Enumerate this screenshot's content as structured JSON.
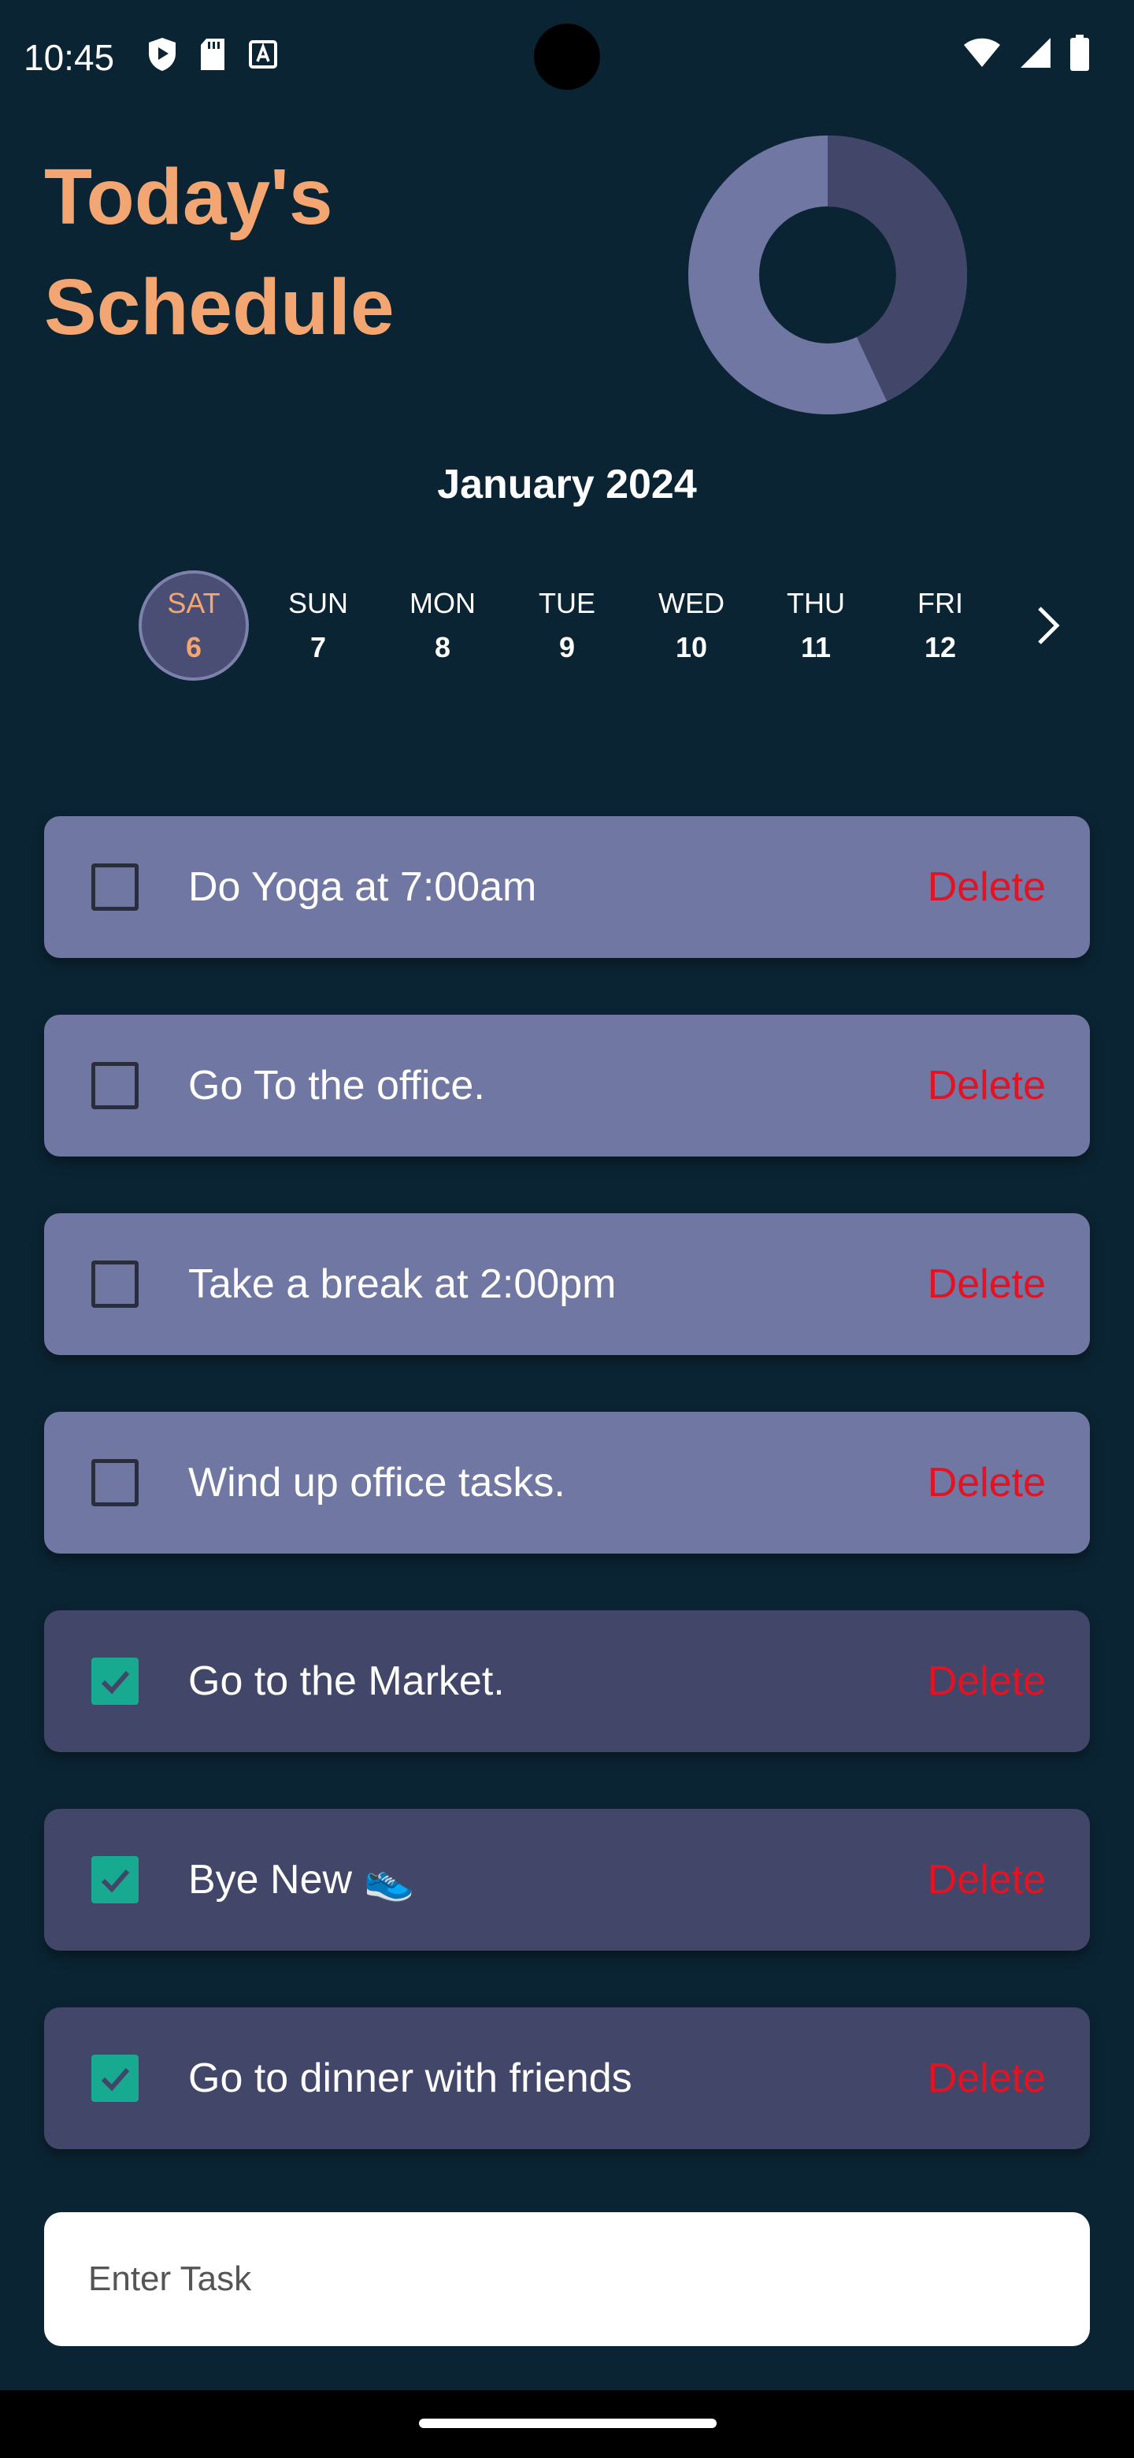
{
  "status_bar": {
    "time": "10:45",
    "left_icons": [
      "shield-icon",
      "sd-card-icon",
      "font-a-icon"
    ],
    "right_icons": [
      "wifi-icon",
      "signal-icon",
      "battery-icon"
    ]
  },
  "header": {
    "title": "Today's Schedule",
    "progress_chart": {
      "completed_fraction": 0.43,
      "colors": {
        "pending": "#6f77a2",
        "completed": "#424668"
      }
    }
  },
  "calendar": {
    "month": "January 2024",
    "days": [
      {
        "dow": "SAT",
        "num": "6",
        "selected": true
      },
      {
        "dow": "SUN",
        "num": "7",
        "selected": false
      },
      {
        "dow": "MON",
        "num": "8",
        "selected": false
      },
      {
        "dow": "TUE",
        "num": "9",
        "selected": false
      },
      {
        "dow": "WED",
        "num": "10",
        "selected": false
      },
      {
        "dow": "THU",
        "num": "11",
        "selected": false
      },
      {
        "dow": "FRI",
        "num": "12",
        "selected": false
      }
    ],
    "next_icon": "chevron-right-icon"
  },
  "tasks": [
    {
      "text": "Do Yoga at 7:00am",
      "done": false,
      "delete_label": "Delete"
    },
    {
      "text": "Go To the office.",
      "done": false,
      "delete_label": "Delete"
    },
    {
      "text": "Take a break at 2:00pm",
      "done": false,
      "delete_label": "Delete"
    },
    {
      "text": "Wind up office tasks.",
      "done": false,
      "delete_label": "Delete"
    },
    {
      "text": "Go to the Market.",
      "done": true,
      "delete_label": "Delete"
    },
    {
      "text": "Bye New 👟",
      "done": true,
      "delete_label": "Delete"
    },
    {
      "text": "Go to dinner with friends",
      "done": true,
      "delete_label": "Delete"
    }
  ],
  "input": {
    "placeholder": "Enter Task",
    "value": ""
  },
  "colors": {
    "background": "#0b2433",
    "title": "#f4a672",
    "card_pending": "#6f77a2",
    "card_done": "#424668",
    "checkbox_checked": "#18a991",
    "delete_text": "#e01424"
  }
}
